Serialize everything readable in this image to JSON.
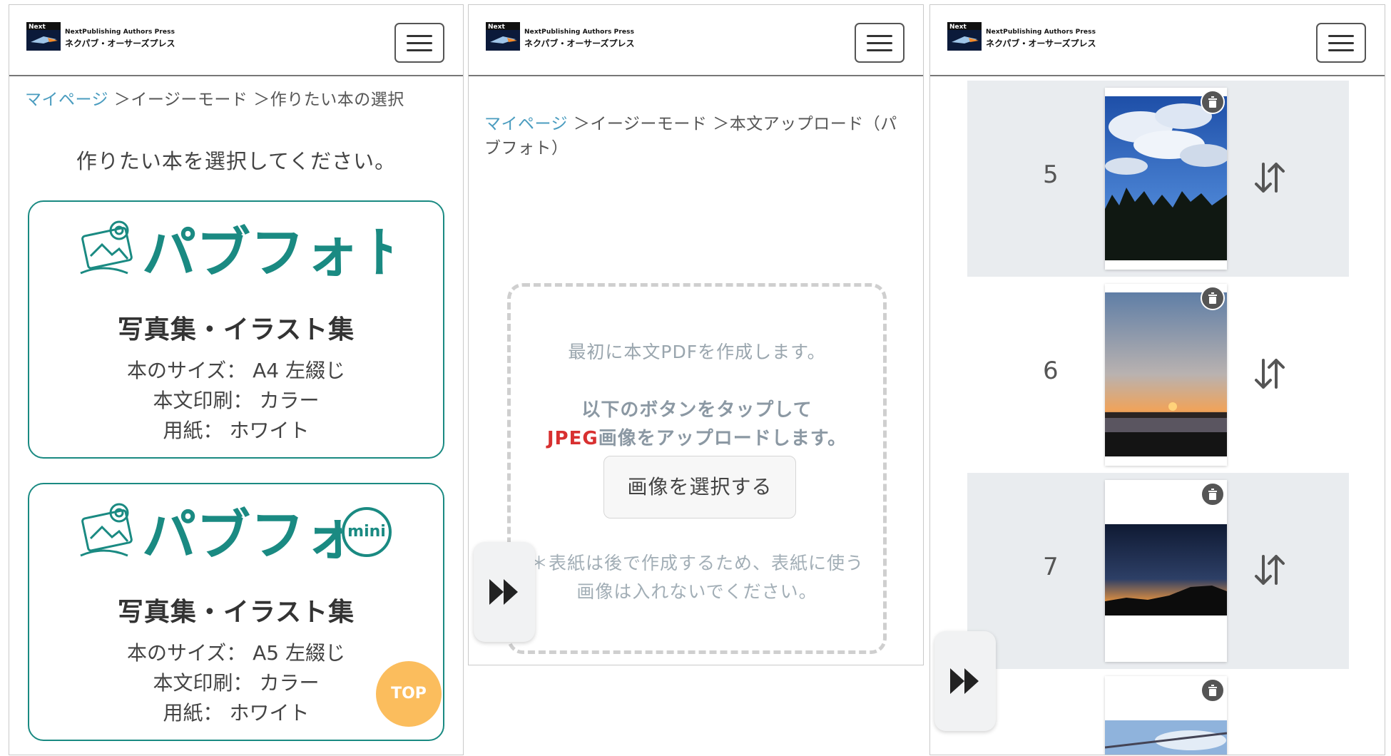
{
  "header": {
    "brand_en": "NextPublishing Authors Press",
    "brand_jp": "ネクパブ・オーサーズプレス"
  },
  "panel1": {
    "breadcrumb": {
      "link": "マイページ",
      "rest": " ＞イージーモード ＞作りたい本の選択"
    },
    "heading": "作りたい本を選択してください。",
    "cards": [
      {
        "logo_text": "パブフォト",
        "title": "写真集・イラスト集",
        "size": "本のサイズ： A4 左綴じ",
        "print": "本文印刷： カラー",
        "paper": "用紙： ホワイト"
      },
      {
        "logo_text": "パブフォト",
        "badge": "mini",
        "title": "写真集・イラスト集",
        "size": "本のサイズ： A5 左綴じ",
        "print": "本文印刷： カラー",
        "paper": "用紙： ホワイト"
      }
    ],
    "top_button": "TOP"
  },
  "panel2": {
    "breadcrumb": {
      "link": "マイページ",
      "rest": " ＞イージーモード ＞本文アップロード（パブフォト）"
    },
    "line1": "最初に本文PDFを作成します。",
    "line2": "以下のボタンをタップして",
    "line3_red": "JPEG",
    "line3_rest": "画像をアップロードします。",
    "select_button": "画像を選択する",
    "note": "＊表紙は後で作成するため、表紙に使う画像は入れないでください。"
  },
  "panel3": {
    "rows": [
      {
        "num": "5"
      },
      {
        "num": "6"
      },
      {
        "num": "7"
      }
    ]
  },
  "colors": {
    "teal": "#1a8a82",
    "link": "#4a9cbf",
    "top": "#fbbd5d",
    "red": "#d83030"
  }
}
